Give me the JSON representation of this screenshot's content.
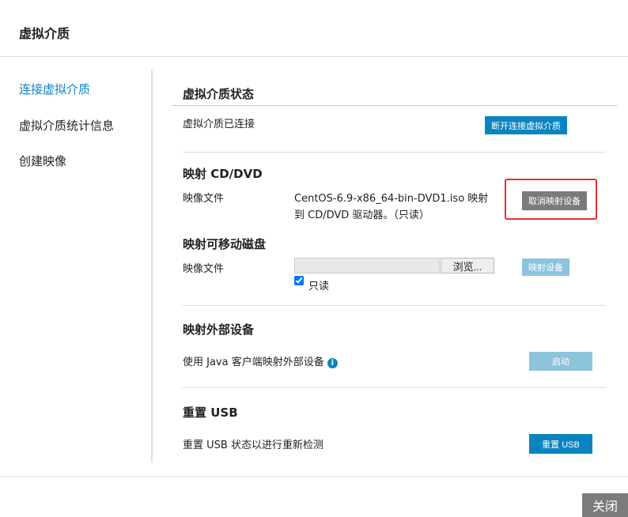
{
  "dialog": {
    "title": "虚拟介质",
    "close_label": "关闭"
  },
  "sidebar": {
    "items": [
      {
        "label": "连接虚拟介质",
        "active": true
      },
      {
        "label": "虚拟介质统计信息"
      },
      {
        "label": "创建映像"
      }
    ]
  },
  "status": {
    "heading": "虚拟介质状态",
    "text": "虚拟介质已连接",
    "disconnect_label": "断开连接虚拟介质"
  },
  "cddvd": {
    "heading": "映射 CD/DVD",
    "field_label": "映像文件",
    "value_line1": "CentOS-6.9-x86_64-bin-DVD1.iso 映射",
    "value_line2": "到 CD/DVD 驱动器。（只读）",
    "unmap_label": "取消映射设备"
  },
  "removable": {
    "heading": "映射可移动磁盘",
    "field_label": "映像文件",
    "file_value": "",
    "browse_label": "浏览...",
    "readonly_label": "只读",
    "readonly_checked": true,
    "map_label": "映射设备"
  },
  "external": {
    "heading": "映射外部设备",
    "text": "使用 Java 客户端映射外部设备",
    "start_label": "启动"
  },
  "usb": {
    "heading": "重置 USB",
    "text": "重置 USB 状态以进行重新检测",
    "reset_label": "重置 USB"
  },
  "colors": {
    "accent": "#0a84c1",
    "highlight": "#e53030"
  }
}
